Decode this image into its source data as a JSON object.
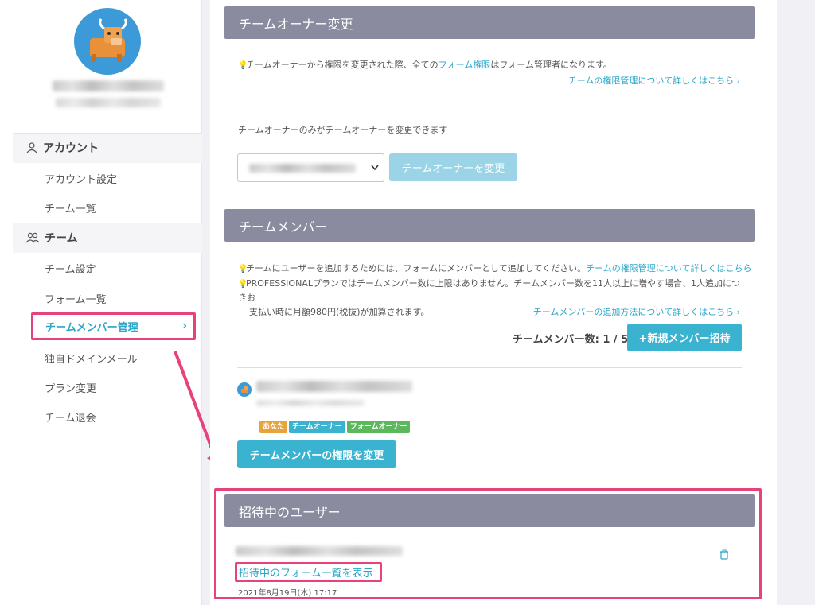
{
  "sidebar": {
    "account_section": "アカウント",
    "account_items": [
      "アカウント設定",
      "チーム一覧"
    ],
    "team_section": "チーム",
    "team_items": [
      "チーム設定",
      "フォーム一覧"
    ],
    "active_item": "チームメンバー管理",
    "team_items_after": [
      "独自ドメインメール",
      "プラン変更",
      "チーム退会"
    ]
  },
  "owner": {
    "header": "チームオーナー変更",
    "note_prefix": "チームオーナーから権限を変更された際、全ての",
    "note_link": "フォーム権限",
    "note_suffix": "はフォーム管理者になります。",
    "detail_link": "チームの権限管理について詳しくはこちら",
    "only_owner_text": "チームオーナーのみがチームオーナーを変更できます",
    "change_button": "チームオーナーを変更"
  },
  "members": {
    "header": "チームメンバー",
    "note1_prefix": "チームにユーザーを追加するためには、フォームにメンバーとして追加してください。",
    "note1_link": "チームの権限管理について詳しくはこちら",
    "note2_line1": "PROFESSIONALプランではチームメンバー数に上限はありません。チームメンバー数を11人以上に増やす場合、1人追加につきお",
    "note2_line2": "支払い時に月額980円(税抜)が加算されます。",
    "add_method_link": "チームメンバーの追加方法について詳しくはこちら",
    "count_label": "チームメンバー数: 1 / 5",
    "invite_button": "+新規メンバー招待",
    "badges": [
      "あなた",
      "チームオーナー",
      "フォームオーナー"
    ],
    "change_perm_button": "チームメンバーの権限を変更"
  },
  "invited": {
    "header": "招待中のユーザー",
    "forms_link": "招待中のフォーム一覧を表示",
    "date": "2021年8月19日(木) 17:17"
  },
  "colors": {
    "accent": "#2aa6c9",
    "highlight": "#e8427b",
    "header_bg": "#8b8ba0",
    "badge_you": "#e8a33d",
    "badge_team_owner": "#3ab3d1",
    "badge_form_owner": "#5cb85c"
  }
}
